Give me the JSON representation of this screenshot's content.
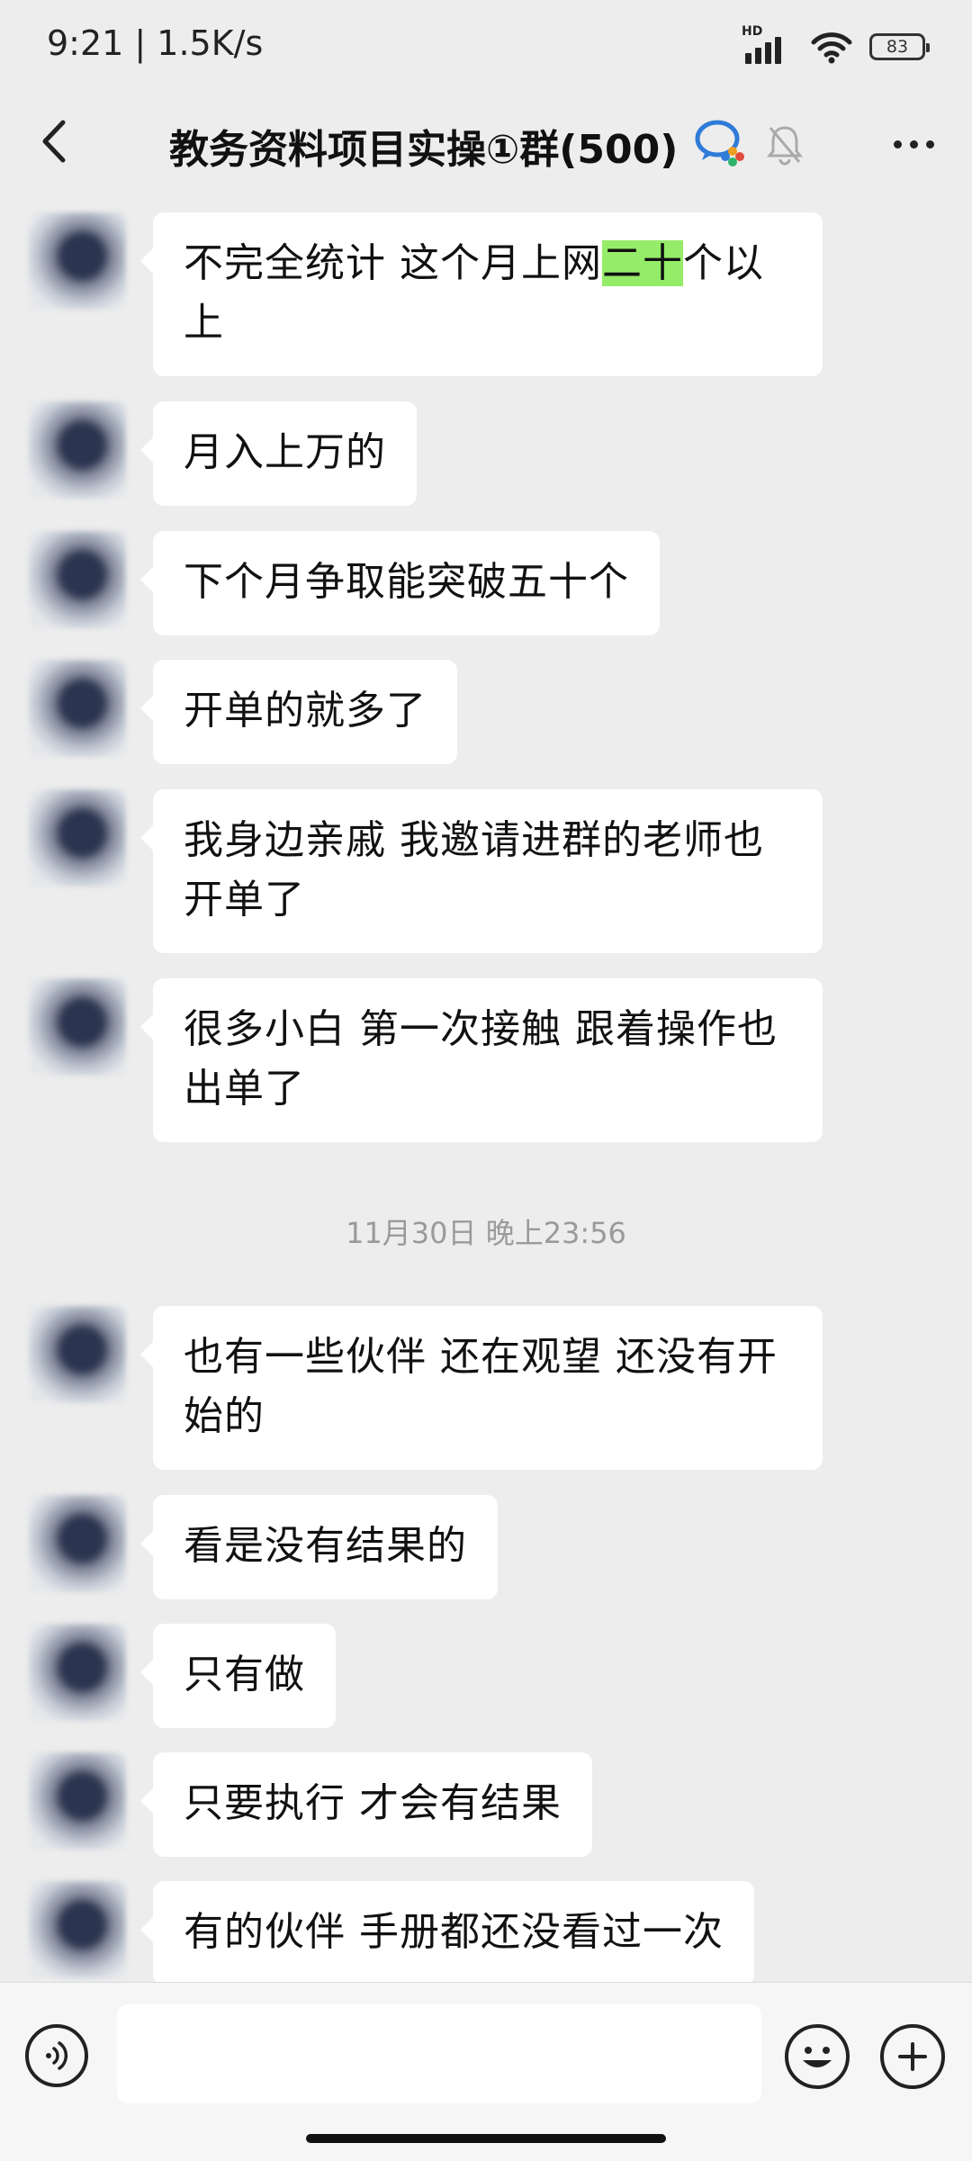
{
  "status_bar": {
    "time": "9:21 | 1.5K/s",
    "network_label": "HD",
    "battery": "83"
  },
  "header": {
    "title": "教务资料项目实操①群(500)"
  },
  "messages": [
    {
      "lines": [
        "不完全统计 这个月上网",
        "二十",
        "个以",
        "上"
      ]
    },
    {
      "text": "月入上万的"
    },
    {
      "text": "下个月争取能突破五十个"
    },
    {
      "text": "开单的就多了"
    },
    {
      "lines": [
        "我身边亲戚 我邀请进群的老师也",
        "开单了"
      ]
    },
    {
      "lines": [
        "很多小白 第一次接触 跟着操作也",
        "出单了"
      ]
    },
    {
      "lines": [
        "也有一些伙伴 还在观望 还没有开",
        "始的"
      ]
    },
    {
      "text": "看是没有结果的"
    },
    {
      "text": "只有做"
    },
    {
      "text": "只要执行 才会有结果"
    },
    {
      "text": "有的伙伴 手册都还没看过一次"
    }
  ],
  "timestamp": "11月30日 晚上23:56",
  "input": {
    "value": ""
  },
  "colors": {
    "background": "#ededed",
    "bubble": "#ffffff",
    "highlight": "#95ec69"
  },
  "icons": {
    "back": "back-arrow-icon",
    "group_badge": "enterprise-chat-icon",
    "mute": "bell-off-icon",
    "more": "more-icon",
    "voice": "voice-icon",
    "emoji": "emoji-icon",
    "plus": "plus-icon"
  }
}
